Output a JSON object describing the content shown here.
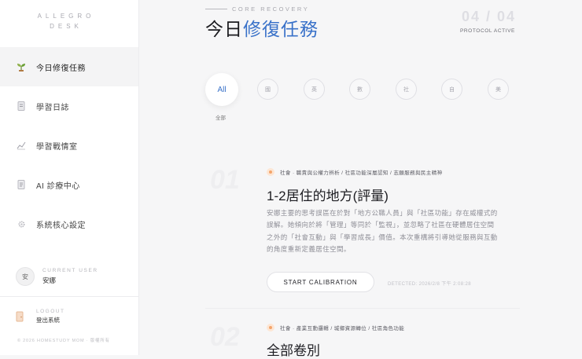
{
  "brand": {
    "line1": "ALLEGRO",
    "line2": "DESK"
  },
  "nav": [
    {
      "label": "今日修復任務",
      "icon": "sprout-icon",
      "active": true
    },
    {
      "label": "學習日誌",
      "icon": "notebook-icon",
      "active": false
    },
    {
      "label": "學習戰情室",
      "icon": "chart-icon",
      "active": false
    },
    {
      "label": "AI 診療中心",
      "icon": "document-icon",
      "active": false
    },
    {
      "label": "系統核心設定",
      "icon": "gear-icon",
      "active": false
    }
  ],
  "user": {
    "caption": "CURRENT USER",
    "name": "安娜",
    "avatar_text": "安"
  },
  "logout": {
    "caption": "LOGOUT",
    "label": "登出系統"
  },
  "copyright": "© 2026 HOMESTUDY MOM · 版權所有",
  "header": {
    "eyebrow": "CORE RECOVERY",
    "title_plain": "今日",
    "title_highlight": "修復任務",
    "counter": "04 / 04",
    "protocol": "PROTOCOL ACTIVE"
  },
  "filters": {
    "all_label": "All",
    "all_caption": "全部",
    "chips": [
      "國",
      "英",
      "數",
      "社",
      "自",
      "美"
    ]
  },
  "cards": [
    {
      "number": "01",
      "tags": "社會 · 職責與公權力辨析 / 社區功能深層認知 / 志願服務與民主精神",
      "title": "1-2居住的地方(評量)",
      "description": "安娜主要的思考誤區在於對「地方公職人員」與「社區功能」存在威權式的誤解。她傾向於將「管理」等同於「監視」，並忽略了社區在硬體居住空間之外的「社會互動」與「學習成長」價值。本次重構將引導她從服務與互動的角度重新定義居住空間。",
      "button": "START CALIBRATION",
      "detected": "DETECTED: 2026/2/8 下午 2:08:28"
    },
    {
      "number": "02",
      "tags": "社會 · 產業互動邏輯 / 城鄉資源轉位 / 社區角色功能",
      "title": "全部卷別"
    }
  ],
  "colors": {
    "accent": "#3a72c9",
    "tag_dot": "#f3a46b"
  }
}
